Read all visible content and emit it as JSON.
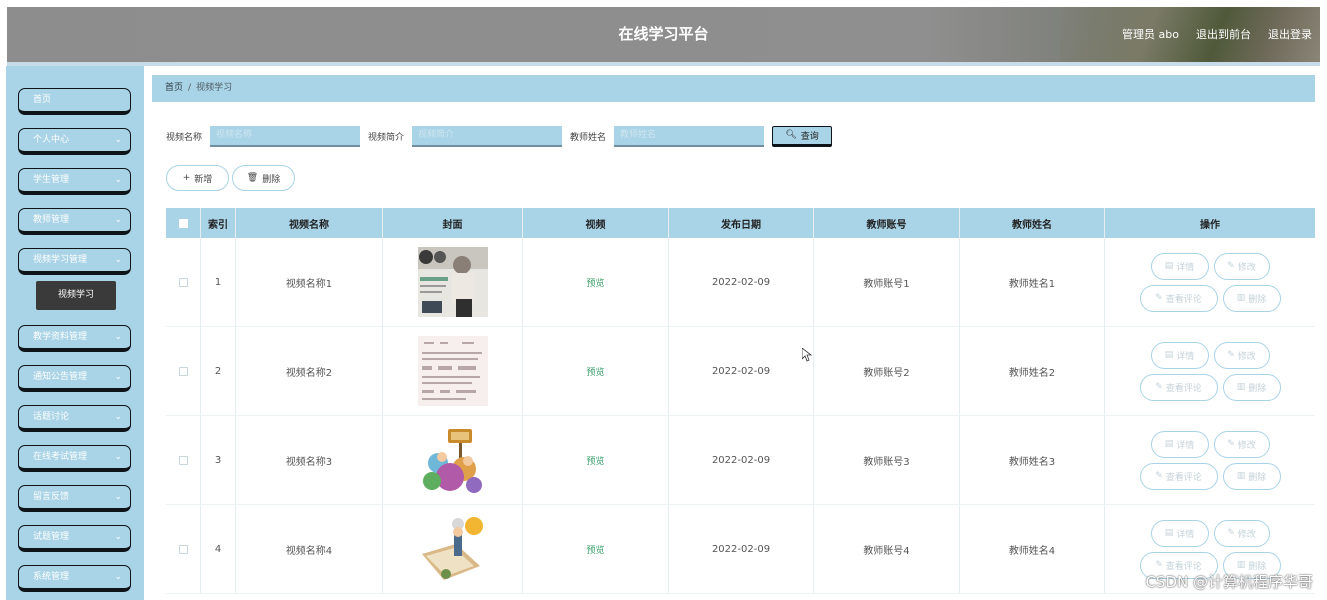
{
  "header": {
    "title": "在线学习平台",
    "admin": "管理员 abo",
    "back_front": "退出到前台",
    "logout": "退出登录"
  },
  "sidebar": {
    "items": [
      {
        "label": "首页",
        "has_chevron": false
      },
      {
        "label": "个人中心",
        "has_chevron": true
      },
      {
        "label": "学生管理",
        "has_chevron": true
      },
      {
        "label": "教师管理",
        "has_chevron": true
      },
      {
        "label": "视频学习管理",
        "has_chevron": true
      },
      {
        "label": "教学资料管理",
        "has_chevron": true
      },
      {
        "label": "通知公告管理",
        "has_chevron": true
      },
      {
        "label": "话题讨论",
        "has_chevron": true
      },
      {
        "label": "在线考试管理",
        "has_chevron": true
      },
      {
        "label": "留言反馈",
        "has_chevron": true
      },
      {
        "label": "试题管理",
        "has_chevron": true
      },
      {
        "label": "系统管理",
        "has_chevron": true
      }
    ],
    "submenu_label": "视频学习"
  },
  "breadcrumb": {
    "home": "首页",
    "current": "视频学习"
  },
  "search": {
    "name_label": "视频名称",
    "name_placeholder": "视频名称",
    "intro_label": "视频简介",
    "intro_placeholder": "视频简介",
    "teacher_label": "教师姓名",
    "teacher_placeholder": "教师姓名",
    "query_button": "查询"
  },
  "actions": {
    "add": "新增",
    "delete": "删除"
  },
  "table": {
    "columns": [
      "索引",
      "视频名称",
      "封面",
      "视频",
      "发布日期",
      "教师账号",
      "教师姓名",
      "操作"
    ],
    "rows": [
      {
        "index": "1",
        "name": "视频名称1",
        "video": "预览",
        "date": "2022-02-09",
        "account": "教师账号1",
        "teacher": "教师姓名1",
        "cover": "photo-man"
      },
      {
        "index": "2",
        "name": "视频名称2",
        "video": "预览",
        "date": "2022-02-09",
        "account": "教师账号2",
        "teacher": "教师姓名2",
        "cover": "document-page"
      },
      {
        "index": "3",
        "name": "视频名称3",
        "video": "预览",
        "date": "2022-02-09",
        "account": "教师账号3",
        "teacher": "教师姓名3",
        "cover": "english-cartoon"
      },
      {
        "index": "4",
        "name": "视频名称4",
        "video": "预览",
        "date": "2022-02-09",
        "account": "教师账号4",
        "teacher": "教师姓名4",
        "cover": "book-cartoon"
      }
    ],
    "ops": {
      "detail": "详情",
      "edit": "修改",
      "comments": "查看评论",
      "remove": "删除"
    }
  },
  "watermark": "CSDN @计算机程序华哥",
  "colors": {
    "accent": "#a9d3e6",
    "header_bg": "#8d8d8d",
    "menu_border": "#0f1418",
    "preview_link": "#3aa06a"
  }
}
